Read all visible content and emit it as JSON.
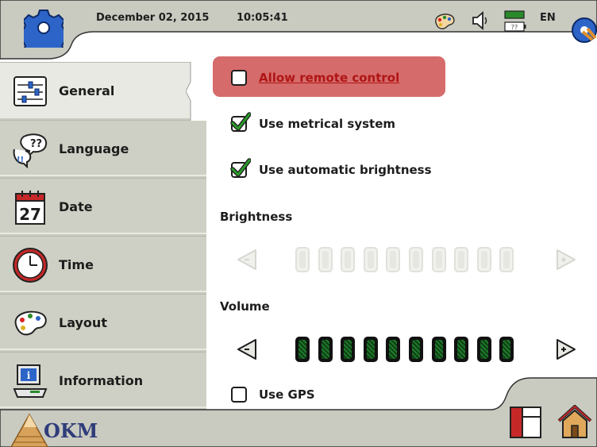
{
  "header": {
    "date": "December  02,  2015",
    "time": "10:05:41",
    "language": "EN",
    "icons": [
      "gear-icon",
      "palette-icon",
      "speaker-icon",
      "battery-icon",
      "network-icon"
    ]
  },
  "sidebar": {
    "items": [
      {
        "label": "General",
        "icon": "sliders-icon",
        "active": true
      },
      {
        "label": "Language",
        "icon": "speech-bubble-icon"
      },
      {
        "label": "Date",
        "icon": "calendar-icon",
        "day": "27"
      },
      {
        "label": "Time",
        "icon": "clock-icon"
      },
      {
        "label": "Layout",
        "icon": "palette-icon"
      },
      {
        "label": "Information",
        "icon": "computer-info-icon"
      }
    ]
  },
  "settings": {
    "remote_control": {
      "label": "Allow remote control",
      "checked": false
    },
    "metric": {
      "label": "Use metrical system",
      "checked": true
    },
    "auto_brightness": {
      "label": "Use automatic brightness",
      "checked": true
    },
    "gps": {
      "label": "Use GPS",
      "checked": false
    }
  },
  "brightness": {
    "title": "Brightness",
    "level": 0,
    "max": 10,
    "enabled": false
  },
  "volume": {
    "title": "Volume",
    "level": 10,
    "max": 10,
    "enabled": true
  },
  "footer": {
    "logo_text": "OKM"
  },
  "colors": {
    "header": "#c9cac0",
    "sidebar": "#cfd0c5",
    "remote_highlight": "#d66b6b",
    "check_green": "#2a9a2a",
    "segment_green": "#1f7a2a"
  }
}
